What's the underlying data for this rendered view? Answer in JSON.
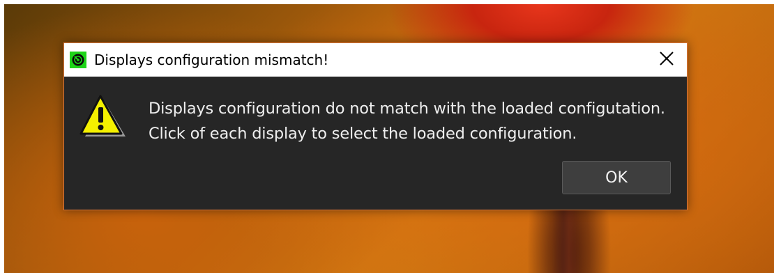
{
  "dialog": {
    "title": "Displays configuration mismatch!",
    "message_line1": "Displays configuration do not match with the loaded configutation.",
    "message_line2": "Click of each display to select the loaded configuration.",
    "ok_label": "OK",
    "icons": {
      "app": "app-logo-icon",
      "close": "close-icon",
      "warning": "warning-icon"
    },
    "colors": {
      "body_bg": "#262626",
      "border": "#e0783a",
      "text": "#eeeeee",
      "app_icon_green": "#1ed418",
      "warning_yellow": "#f4f000"
    }
  }
}
